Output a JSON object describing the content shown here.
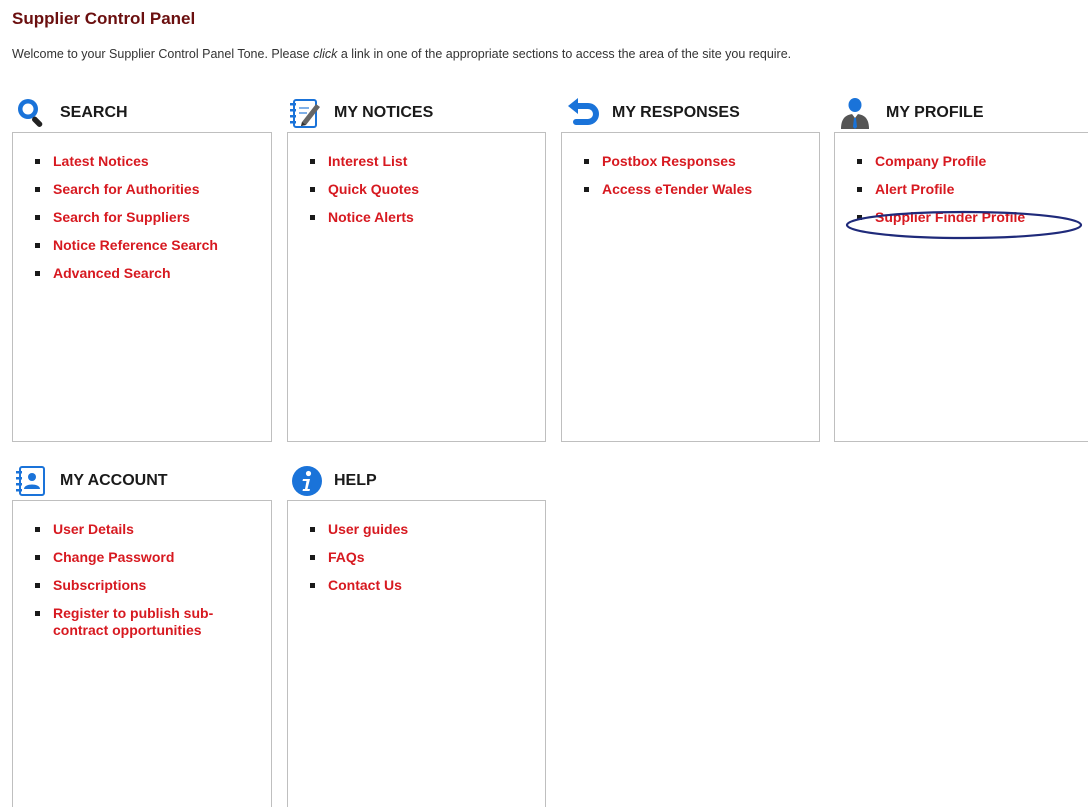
{
  "page": {
    "title": "Supplier Control Panel",
    "welcome_prefix": "Welcome to your Supplier Control Panel Tone. Please ",
    "welcome_emphasis": "click",
    "welcome_suffix": " a link in one of the appropriate sections to access the area of the site you require."
  },
  "sections": {
    "search": {
      "title": "SEARCH",
      "icon": "magnifier-icon",
      "links": [
        "Latest Notices",
        "Search for Authorities",
        "Search for Suppliers",
        "Notice Reference Search",
        "Advanced Search"
      ]
    },
    "notices": {
      "title": "MY NOTICES",
      "icon": "notepad-pencil-icon",
      "links": [
        "Interest List",
        "Quick Quotes",
        "Notice Alerts"
      ]
    },
    "responses": {
      "title": "MY RESPONSES",
      "icon": "return-arrow-icon",
      "links": [
        "Postbox Responses",
        "Access eTender Wales"
      ]
    },
    "profile": {
      "title": "MY PROFILE",
      "icon": "business-person-icon",
      "links": [
        "Company Profile",
        "Alert Profile",
        "Supplier Finder Profile"
      ]
    },
    "account": {
      "title": "MY ACCOUNT",
      "icon": "address-book-icon",
      "links": [
        "User Details",
        "Change Password",
        "Subscriptions",
        "Register to publish sub-contract opportunities"
      ]
    },
    "help": {
      "title": "HELP",
      "icon": "info-icon",
      "links": [
        "User guides",
        "FAQs",
        "Contact Us"
      ]
    }
  },
  "colors": {
    "title": "#6b0f0f",
    "link": "#d71920",
    "icon_blue": "#1a73d9",
    "annotation": "#1f2a7a"
  }
}
